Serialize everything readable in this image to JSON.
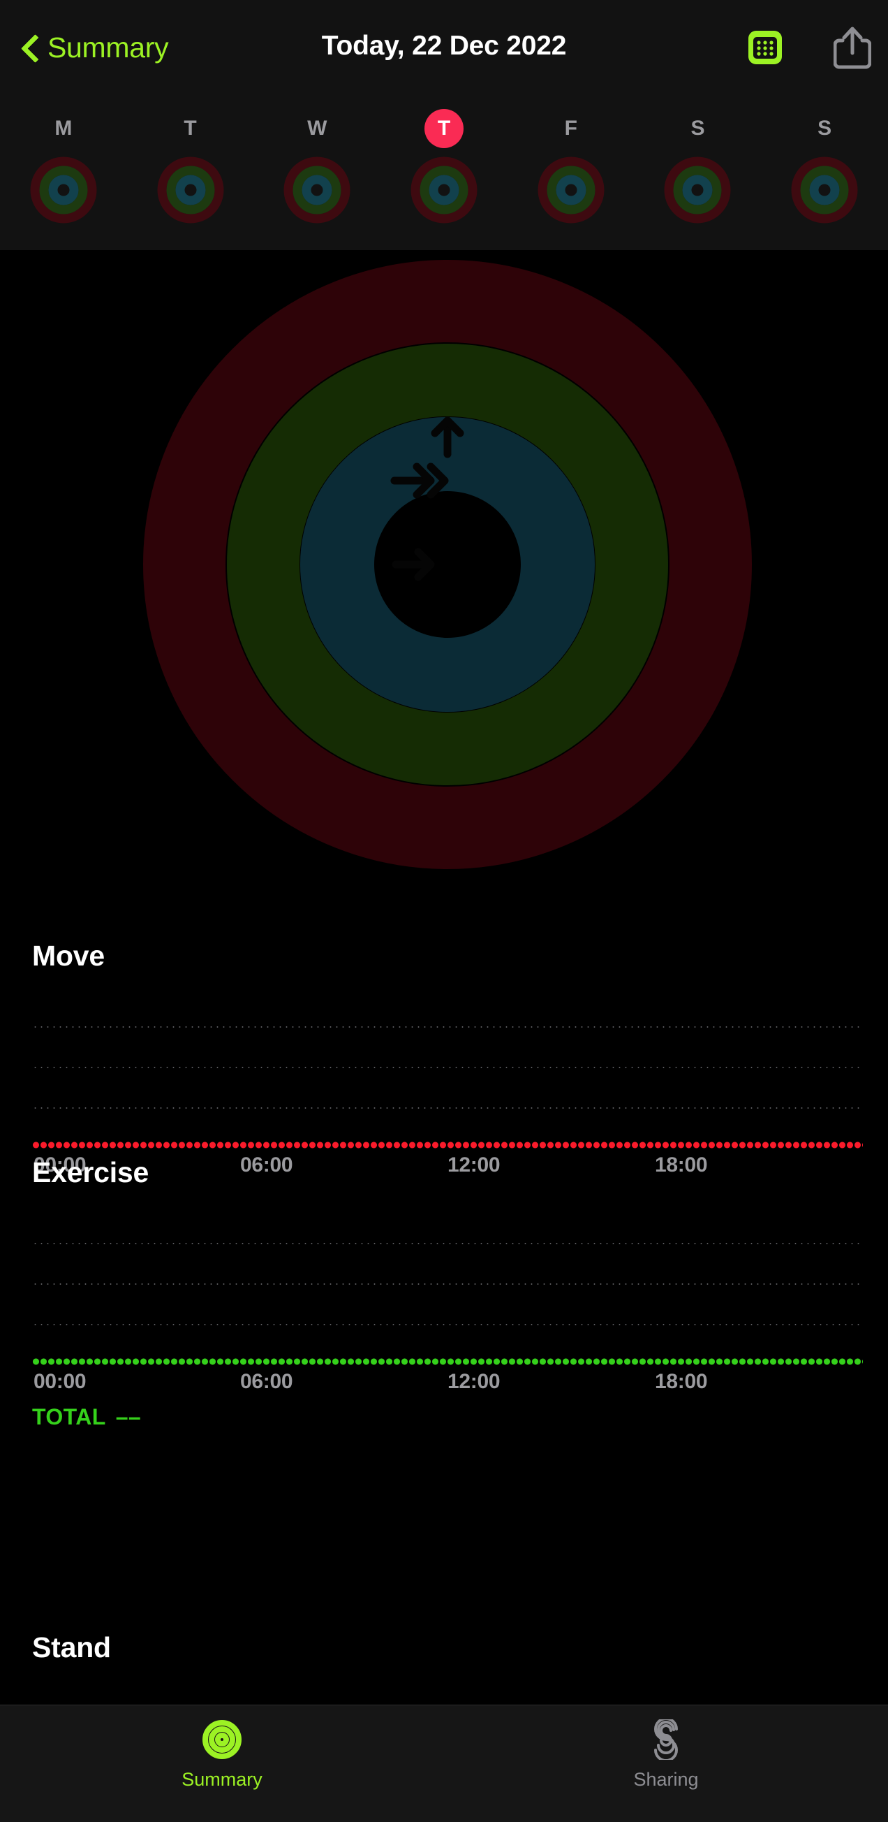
{
  "app": {
    "background": "#000000",
    "accent_green": "#9cf224",
    "move_color": "#fa1b2b",
    "exercise_color": "#35d11b",
    "stand_color": "#1ad7e4",
    "selected_badge_color": "#fa2b54"
  },
  "navbar": {
    "back_label": "Summary",
    "title": "Today, 22 Dec 2022",
    "back_icon": "chevron-left-icon",
    "calendar_icon": "calendar-icon",
    "share_icon": "share-icon"
  },
  "week_strip": {
    "days": [
      {
        "label": "M",
        "selected": false
      },
      {
        "label": "T",
        "selected": false
      },
      {
        "label": "W",
        "selected": false
      },
      {
        "label": "T",
        "selected": true
      },
      {
        "label": "F",
        "selected": false
      },
      {
        "label": "S",
        "selected": false
      },
      {
        "label": "S",
        "selected": false
      }
    ]
  },
  "main_rings": {
    "move_icon": "arrow-right-icon",
    "exercise_icon": "double-chevron-right-icon",
    "stand_icon": "arrow-up-icon",
    "move_progress_pct": 0,
    "exercise_progress_pct": 0,
    "stand_progress_pct": 0
  },
  "sections": [
    {
      "title": "Move",
      "color": "#fa1b2b",
      "ticks": [
        "00:00",
        "06:00",
        "12:00",
        "18:00"
      ],
      "total_label": null,
      "total_value": null
    },
    {
      "title": "Exercise",
      "color": "#35d11b",
      "ticks": [
        "00:00",
        "06:00",
        "12:00",
        "18:00"
      ],
      "total_label": "TOTAL",
      "total_value": "––"
    },
    {
      "title": "Stand",
      "color": "#1ad7e4",
      "ticks": [],
      "total_label": null,
      "total_value": null
    }
  ],
  "chart_data": [
    {
      "type": "line",
      "title": "Move",
      "xlabel": "",
      "ylabel": "",
      "x": [
        "00:00",
        "06:00",
        "12:00",
        "18:00"
      ],
      "series": [
        {
          "name": "Move",
          "values": [
            0,
            0,
            0,
            0
          ]
        }
      ],
      "ylim": [
        0,
        4
      ],
      "grid": true,
      "gridlines": 3,
      "legend": "none",
      "color": "#fa1b2b",
      "note": "All values zero; dotted baseline at y=0 across full day"
    },
    {
      "type": "line",
      "title": "Exercise",
      "xlabel": "",
      "ylabel": "",
      "x": [
        "00:00",
        "06:00",
        "12:00",
        "18:00"
      ],
      "series": [
        {
          "name": "Exercise",
          "values": [
            0,
            0,
            0,
            0
          ]
        }
      ],
      "ylim": [
        0,
        4
      ],
      "grid": true,
      "gridlines": 3,
      "legend": "none",
      "color": "#35d11b",
      "annotation": "TOTAL ––",
      "note": "All values zero; dotted baseline at y=0 across full day"
    }
  ],
  "tabbar": {
    "items": [
      {
        "label": "Summary",
        "icon": "activity-rings-icon",
        "active": true
      },
      {
        "label": "Sharing",
        "icon": "sharing-s-icon",
        "active": false
      }
    ]
  }
}
